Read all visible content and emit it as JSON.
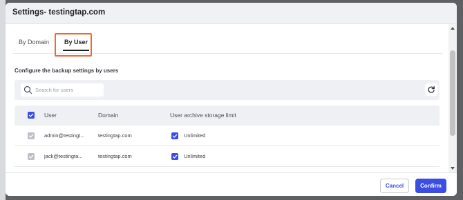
{
  "dialog": {
    "title": "Settings- testingtap.com"
  },
  "tabs": [
    {
      "label": "By Domain",
      "active": false
    },
    {
      "label": "By User",
      "active": true
    }
  ],
  "section_label": "Configure the backup settings by users",
  "search": {
    "placeholder": "Search for users",
    "value": "",
    "icon": "search-icon"
  },
  "refresh": {
    "icon": "refresh-icon"
  },
  "table": {
    "columns": [
      "User",
      "Domain",
      "User archive storage limit"
    ],
    "select_all_checked": true,
    "rows": [
      {
        "user": "admin@testingt...",
        "domain": "testingtap.com",
        "limit": "Unlimited",
        "selected": true,
        "limit_checked": true
      },
      {
        "user": "jack@testingta...",
        "domain": "testingtap.com",
        "limit": "Unlimited",
        "selected": true,
        "limit_checked": true
      },
      {
        "user": "",
        "domain": "",
        "limit": "",
        "selected": true,
        "limit_checked": true
      }
    ]
  },
  "footer": {
    "cancel_label": "Cancel",
    "confirm_label": "Confirm"
  },
  "colors": {
    "accent": "#3b4de3",
    "highlight_outline": "#ee6a2c",
    "disabled_checkbox": "#bcc0c6"
  }
}
